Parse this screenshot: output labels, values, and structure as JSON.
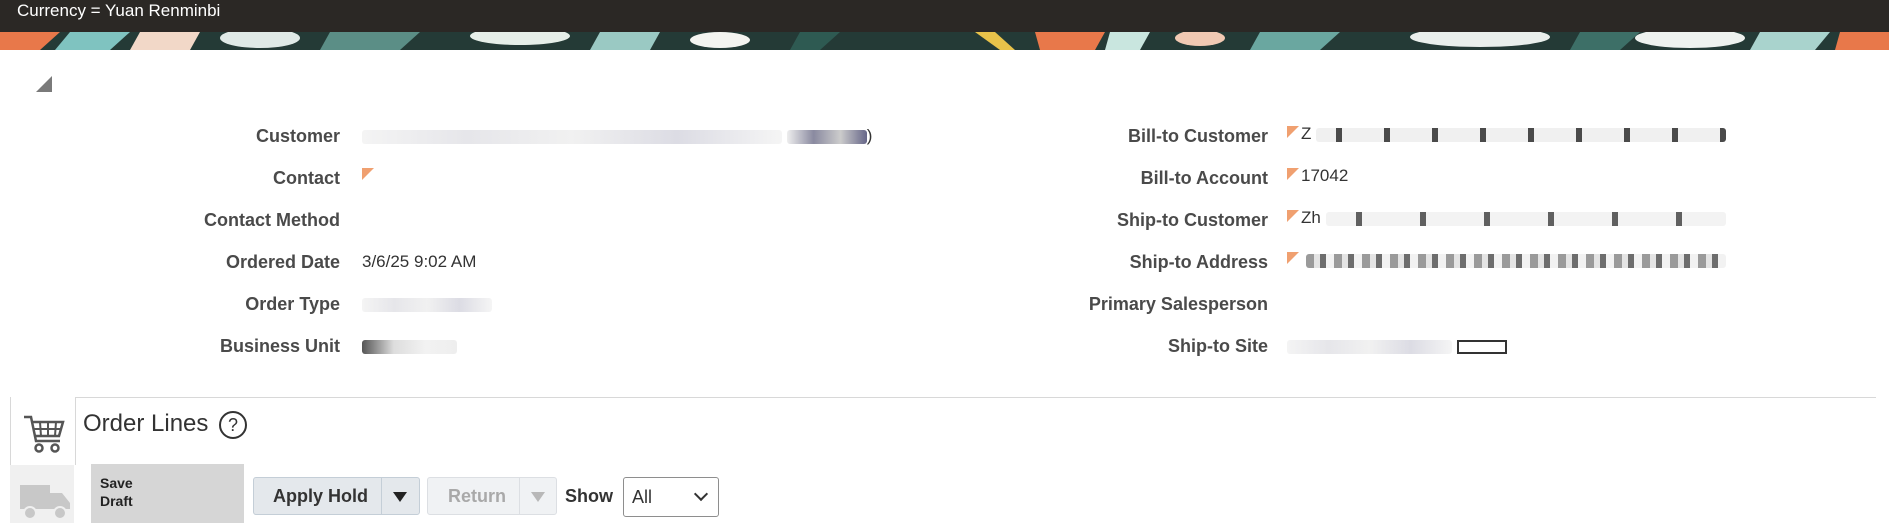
{
  "topbar": {
    "currency_text": "Currency = Yuan Renminbi"
  },
  "header_fields_left": [
    {
      "label": "Customer",
      "value": ")"
    },
    {
      "label": "Contact",
      "value": ""
    },
    {
      "label": "Contact Method",
      "value": ""
    },
    {
      "label": "Ordered Date",
      "value": "3/6/25 9:02 AM"
    },
    {
      "label": "Order Type",
      "value": ""
    },
    {
      "label": "Business Unit",
      "value": ""
    }
  ],
  "header_fields_right": [
    {
      "label": "Bill-to Customer",
      "value": "Z"
    },
    {
      "label": "Bill-to Account",
      "value": "17042"
    },
    {
      "label": "Ship-to Customer",
      "value": "Zh"
    },
    {
      "label": "Ship-to Address",
      "value": ""
    },
    {
      "label": "Primary Salesperson",
      "value": ""
    },
    {
      "label": "Ship-to Site",
      "value": ""
    }
  ],
  "order_lines": {
    "title": "Order Lines",
    "help_icon_glyph": "?",
    "thumbnail_text_line1": "Save",
    "thumbnail_text_line2": "Draft",
    "apply_hold_label": "Apply Hold",
    "return_label": "Return",
    "show_label": "Show",
    "show_selected": "All"
  },
  "icons": {
    "collapse": "collapse-triangle-icon",
    "cart": "shopping-cart-icon",
    "truck": "delivery-truck-icon",
    "help": "help-circle-icon"
  },
  "colors": {
    "topbar_bg": "#2b2825",
    "flag_orange": "#f0a070",
    "button_bg": "#e4e8ec"
  }
}
